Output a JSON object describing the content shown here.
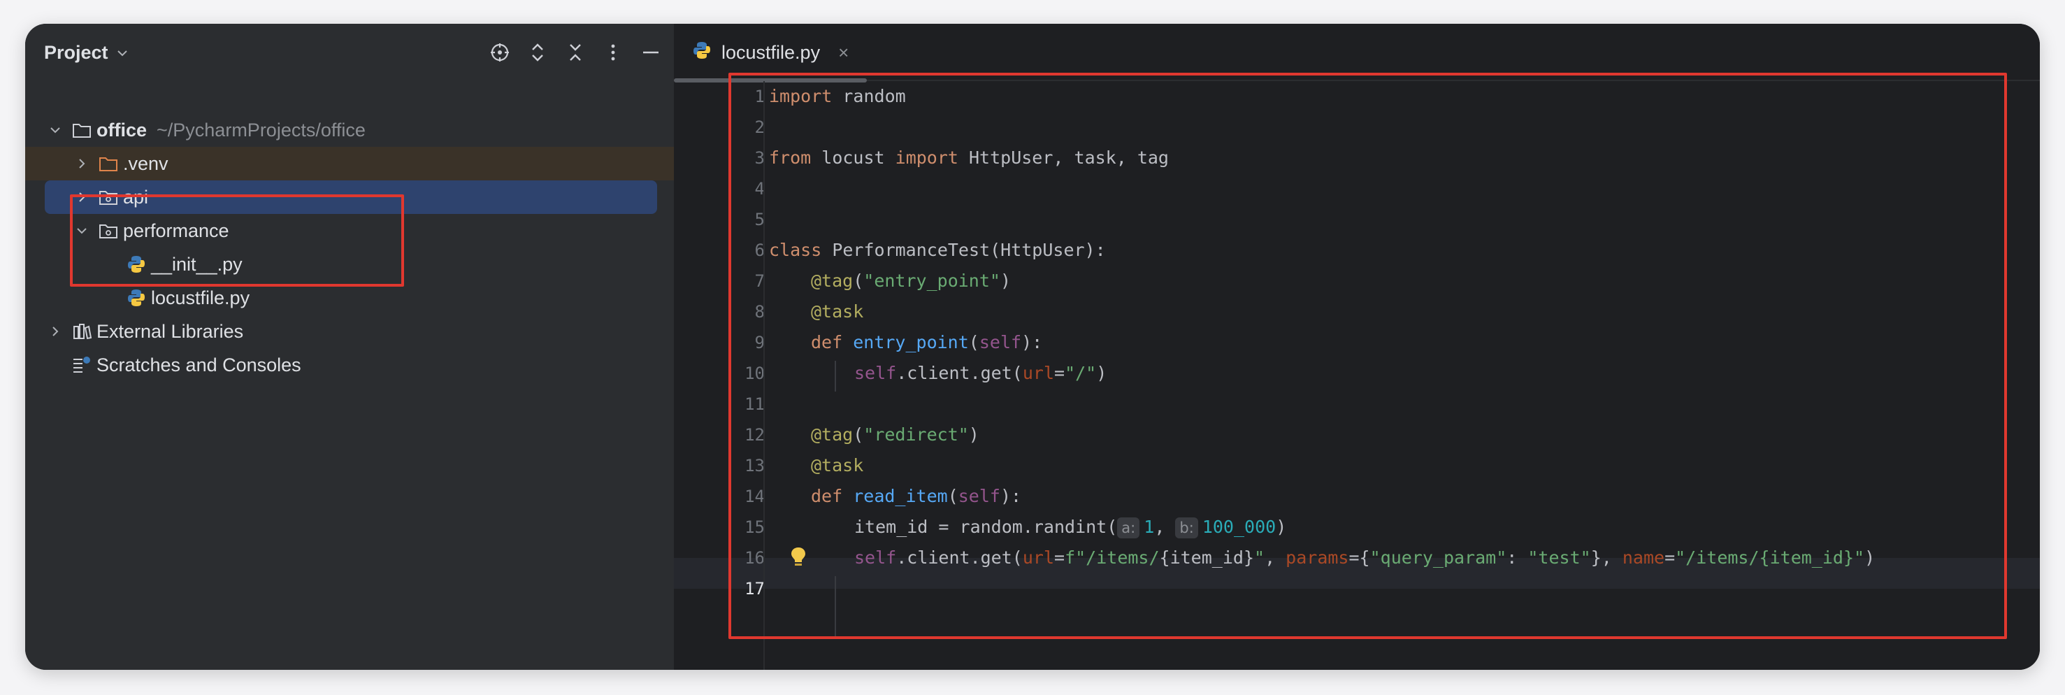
{
  "project_panel": {
    "title": "Project",
    "title_icon": "chevron-down-icon",
    "actions": [
      "locate-icon",
      "expand-all-icon",
      "collapse-all-icon",
      "more-options-icon",
      "hide-icon"
    ],
    "tree": {
      "root": {
        "label": "office",
        "path": "~/PycharmProjects/office"
      },
      "venv": {
        "label": ".venv"
      },
      "api": {
        "label": "api"
      },
      "performance": {
        "label": "performance"
      },
      "init_file": {
        "label": "__init__.py"
      },
      "locust_file": {
        "label": "locustfile.py"
      },
      "external_libraries": {
        "label": "External Libraries"
      },
      "scratches": {
        "label": "Scratches and Consoles"
      }
    }
  },
  "editor": {
    "tab": {
      "label": "locustfile.py",
      "close": "×"
    },
    "current_line": 17,
    "line_numbers": [
      "1",
      "2",
      "3",
      "4",
      "5",
      "6",
      "7",
      "8",
      "9",
      "10",
      "11",
      "12",
      "13",
      "14",
      "15",
      "16",
      "17"
    ],
    "code": {
      "l1": {
        "kw": "import",
        "rest": " random"
      },
      "l3": {
        "kw1": "from",
        "mod": " locust ",
        "kw2": "import",
        "rest": " HttpUser, task, tag"
      },
      "l6": {
        "kw": "class",
        "rest": " PerformanceTest(HttpUser):"
      },
      "l7": {
        "dec": "@tag",
        "open": "(",
        "str": "\"entry_point\"",
        "close": ")"
      },
      "l8": {
        "dec": "@task"
      },
      "l9": {
        "kw": "def",
        "fn": "entry_point",
        "open": "(",
        "self": "self",
        "close": "):"
      },
      "l10": {
        "self": "self",
        "mid": ".client.get(",
        "param": "url",
        "eq": "=",
        "str": "\"/\"",
        "close": ")"
      },
      "l12": {
        "dec": "@tag",
        "open": "(",
        "str": "\"redirect\"",
        "close": ")"
      },
      "l13": {
        "dec": "@task"
      },
      "l14": {
        "kw": "def",
        "fn": "read_item",
        "open": "(",
        "self": "self",
        "close": "):"
      },
      "l15": {
        "start": "item_id = random.randint(",
        "hint_a": "a:",
        "num_a": "1",
        "sep": ", ",
        "hint_b": "b:",
        "num_b": "100_000",
        "close": ")"
      },
      "l16": {
        "self": "self",
        "mid": ".client.get(",
        "param1": "url",
        "eq1": "=",
        "str1": "f\"/items/",
        "brace1": "{item_id}",
        "str1_end": "\"",
        "comma1": ", ",
        "param2": "params",
        "eq2": "={",
        "str2": "\"query_param\"",
        "colon": ": ",
        "str3": "\"test\"",
        "comma2": "}, ",
        "param3": "name",
        "eq3": "=",
        "str4": "\"/items/{item_id}\"",
        "close": ")"
      }
    }
  },
  "colors": {
    "highlight_box": "#e0382f",
    "selection": "#2e436e",
    "keyword": "#cf8e6d",
    "function": "#56a8f5",
    "string": "#6aab73"
  }
}
